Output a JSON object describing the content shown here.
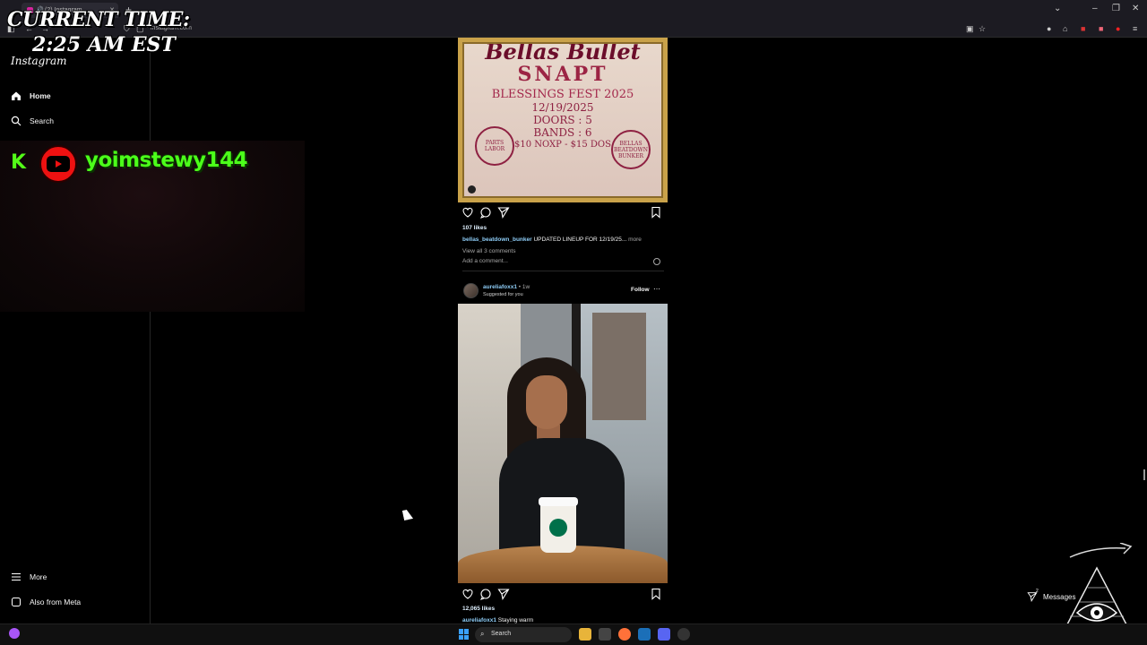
{
  "browser": {
    "tab_title": "(2) Instagram",
    "url": "instagram.com"
  },
  "overlay": {
    "clock_line1": "CURRENT TIME:",
    "clock_line2": "2:25 AM EST",
    "kick_letter": "K",
    "handle": "yoimstewy144"
  },
  "sidebar": {
    "logo": "Instagram",
    "items": [
      {
        "label": "Home",
        "icon": "home-icon"
      },
      {
        "label": "Search",
        "icon": "search-icon"
      }
    ],
    "bottom": [
      {
        "label": "More",
        "icon": "menu-icon"
      },
      {
        "label": "Also from Meta",
        "icon": "meta-icon"
      }
    ]
  },
  "feed": {
    "post1": {
      "poster": {
        "header": "Bellas Bullet",
        "brand": "SNAPT",
        "fest": "BLESSINGS FEST 2025",
        "date": "12/19/2025",
        "doors": "DOORS : 5",
        "bands": "BANDS : 6",
        "price": "$10 NOXP - $15 DOS",
        "badge_left": "PARTS LABOR",
        "badge_right": "BELLAS BEATDOWN BUNKER"
      },
      "likes": "107 likes",
      "caption_user": "bellas_beatdown_bunker",
      "caption_text": "UPDATED LINEUP FOR 12/19/25...",
      "caption_more": "more",
      "view_comments": "View all 3 comments",
      "add_comment": "Add a comment..."
    },
    "post2": {
      "username": "aureliafoxx1",
      "age": "• 1w",
      "suggested": "Suggested for you",
      "follow": "Follow",
      "likes": "12,065 likes",
      "caption_user": "aureliafoxx1",
      "caption_text": "Staying warm"
    }
  },
  "messages": {
    "label": "Messages",
    "badge": "2"
  },
  "taskbar": {
    "search_placeholder": "Search"
  },
  "colors": {
    "kick_green": "#53fc18",
    "youtube_red": "#ee1111",
    "link_blue": "#8ecdf7"
  }
}
